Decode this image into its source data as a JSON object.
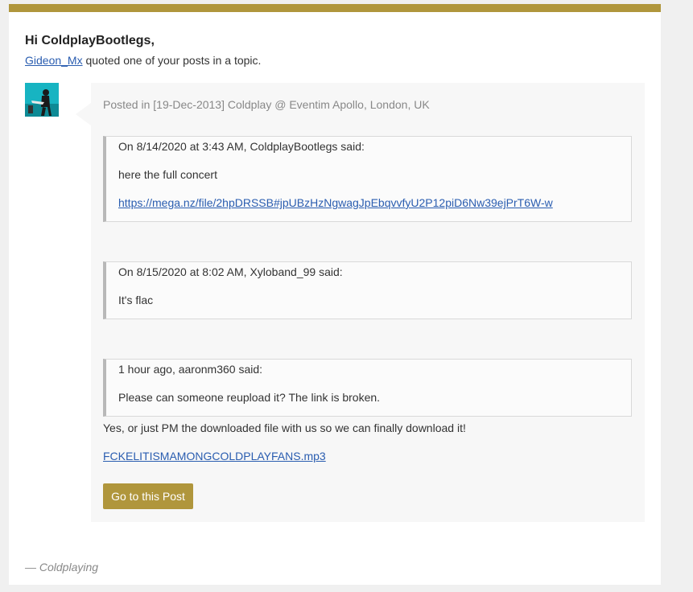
{
  "email": {
    "greeting": "Hi ColdplayBootlegs,",
    "quoter_name": "Gideon_Mx",
    "intro_suffix": " quoted one of your posts in a topic.",
    "posted_in": "Posted in [19-Dec-2013] Coldplay @ Eventim Apollo, London, UK",
    "quotes": [
      {
        "header": "On 8/14/2020 at 3:43 AM, ColdplayBootlegs said:",
        "text": "here the full concert",
        "link": "https://mega.nz/file/2hpDRSSB#jpUBzHzNgwagJpEbqvvfyU2P12piD6Nw39ejPrT6W-w"
      },
      {
        "header": "On 8/15/2020 at 8:02 AM, Xyloband_99 said:",
        "text": "It's flac"
      },
      {
        "header": "1 hour ago, aaronm360 said:",
        "text": "Please can someone reupload it? The link is broken."
      }
    ],
    "reply_text": "Yes, or just PM the downloaded file with us so we can finally download it!",
    "reply_file": "FCKELITISMAMONGCOLDPLAYFANS.mp3",
    "button_label": "Go to this Post",
    "signature": "— Coldplaying"
  },
  "colors": {
    "accent": "#b0963c",
    "link": "#2a5db0",
    "card_bg": "#f7f7f7",
    "page_bg": "#f0f0f0"
  },
  "icons": {
    "avatar": "user-avatar-guitarist"
  }
}
